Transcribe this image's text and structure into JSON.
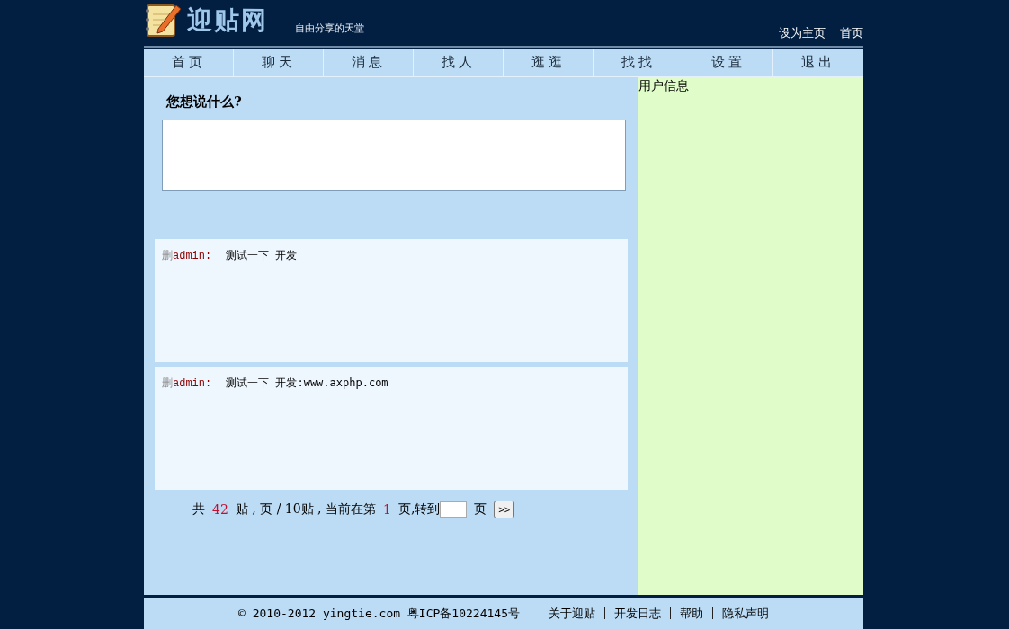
{
  "header": {
    "site_name": "迎贴网",
    "slogan": "自由分享的天堂",
    "links": [
      "设为主页",
      "首页"
    ]
  },
  "nav": [
    "首页",
    "聊天",
    "消息",
    "找人",
    "逛逛",
    "找找",
    "设置",
    "退出"
  ],
  "composer": {
    "heading": "您想说什么?"
  },
  "posts": [
    {
      "delete": "删",
      "author": "admin:",
      "text": "测试一下 开发"
    },
    {
      "delete": "删",
      "author": "admin:",
      "text": "测试一下 开发:www.axphp.com"
    }
  ],
  "pagination": {
    "total_prefix": "共",
    "total": "42",
    "middle": "贴 , 页 / 10贴 , 当前在第",
    "current": "1",
    "goto": "页,转到",
    "page_suffix": "页",
    "go_button": ">>"
  },
  "sidebar": {
    "title": "用户信息"
  },
  "footer": {
    "copyright": "© 2010-2012 yingtie.com 粤ICP备10224145号",
    "links": [
      "关于迎贴",
      "开发日志",
      "帮助",
      "隐私声明"
    ]
  }
}
